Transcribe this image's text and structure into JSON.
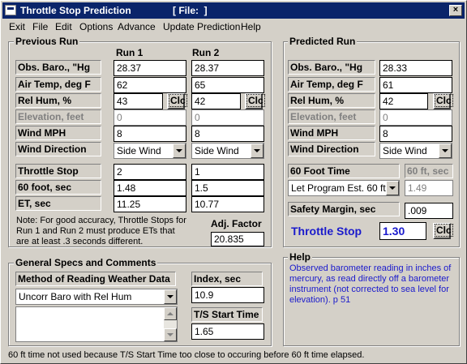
{
  "window": {
    "title": "Throttle Stop Prediction",
    "file_label": "[ File:  ]",
    "close": "×"
  },
  "menu": [
    "Exit",
    "File",
    "Edit",
    "Options",
    "Advance",
    "Update Prediction",
    "Help"
  ],
  "previous_run": {
    "title": "Previous Run",
    "run1_header": "Run 1",
    "run2_header": "Run 2",
    "labels": {
      "baro": "Obs. Baro., \"Hg",
      "air_temp": "Air Temp, deg F",
      "rel_hum": "Rel Hum, %",
      "elevation": "Elevation, feet",
      "wind_mph": "Wind MPH",
      "wind_dir": "Wind Direction",
      "throttle_stop": "Throttle Stop",
      "sixty_foot": "60 foot, sec",
      "et": "ET, sec"
    },
    "run1": {
      "baro": "28.37",
      "air_temp": "62",
      "rel_hum": "43",
      "elevation": "0",
      "wind_mph": "8",
      "wind_dir": "Side Wind",
      "throttle_stop": "2",
      "sixty_foot": "1.48",
      "et": "11.25"
    },
    "run2": {
      "baro": "28.37",
      "air_temp": "65",
      "rel_hum": "42",
      "elevation": "0",
      "wind_mph": "8",
      "wind_dir": "Side Wind",
      "throttle_stop": "1",
      "sixty_foot": "1.5",
      "et": "10.77"
    },
    "clc": "Clc",
    "note": [
      "Note:  For good accuracy, Throttle Stops for",
      "Run 1 and Run 2 must produce ETs that",
      "are at least .3 seconds different."
    ],
    "adj_factor_label": "Adj. Factor",
    "adj_factor": "20.835"
  },
  "predicted_run": {
    "title": "Predicted Run",
    "labels": {
      "baro": "Obs. Baro., \"Hg",
      "air_temp": "Air Temp, deg F",
      "rel_hum": "Rel Hum, %",
      "elevation": "Elevation, feet",
      "wind_mph": "Wind MPH",
      "wind_dir": "Wind Direction",
      "sixty_foot_time": "60 Foot Time",
      "sixty_ft_sec": "60 ft, sec",
      "safety_margin": "Safety Margin, sec",
      "throttle_stop": "Throttle Stop"
    },
    "values": {
      "baro": "28.33",
      "air_temp": "61",
      "rel_hum": "42",
      "elevation": "0",
      "wind_mph": "8",
      "wind_dir": "Side Wind",
      "sixty_ft_mode": "Let Program Est. 60 ft tim",
      "sixty_ft_sec": "1.49",
      "safety_margin": ".009",
      "throttle_stop": "1.30"
    },
    "clc": "Clc"
  },
  "general": {
    "title": "General Specs and Comments",
    "method_label": "Method of Reading Weather Data",
    "method_value": "Uncorr Baro with Rel Hum",
    "index_label": "Index, sec",
    "index_value": "10.9",
    "ts_start_label": "T/S Start Time",
    "ts_start_value": "1.65"
  },
  "help": {
    "title": "Help",
    "text": [
      "Observed barometer reading in inches of",
      "mercury, as read directly off a barometer",
      "instrument (not corrected to sea level for",
      "elevation).   p 51"
    ]
  },
  "status": "60 ft time not used because T/S Start Time too close to occuring before 60 ft time elapsed."
}
